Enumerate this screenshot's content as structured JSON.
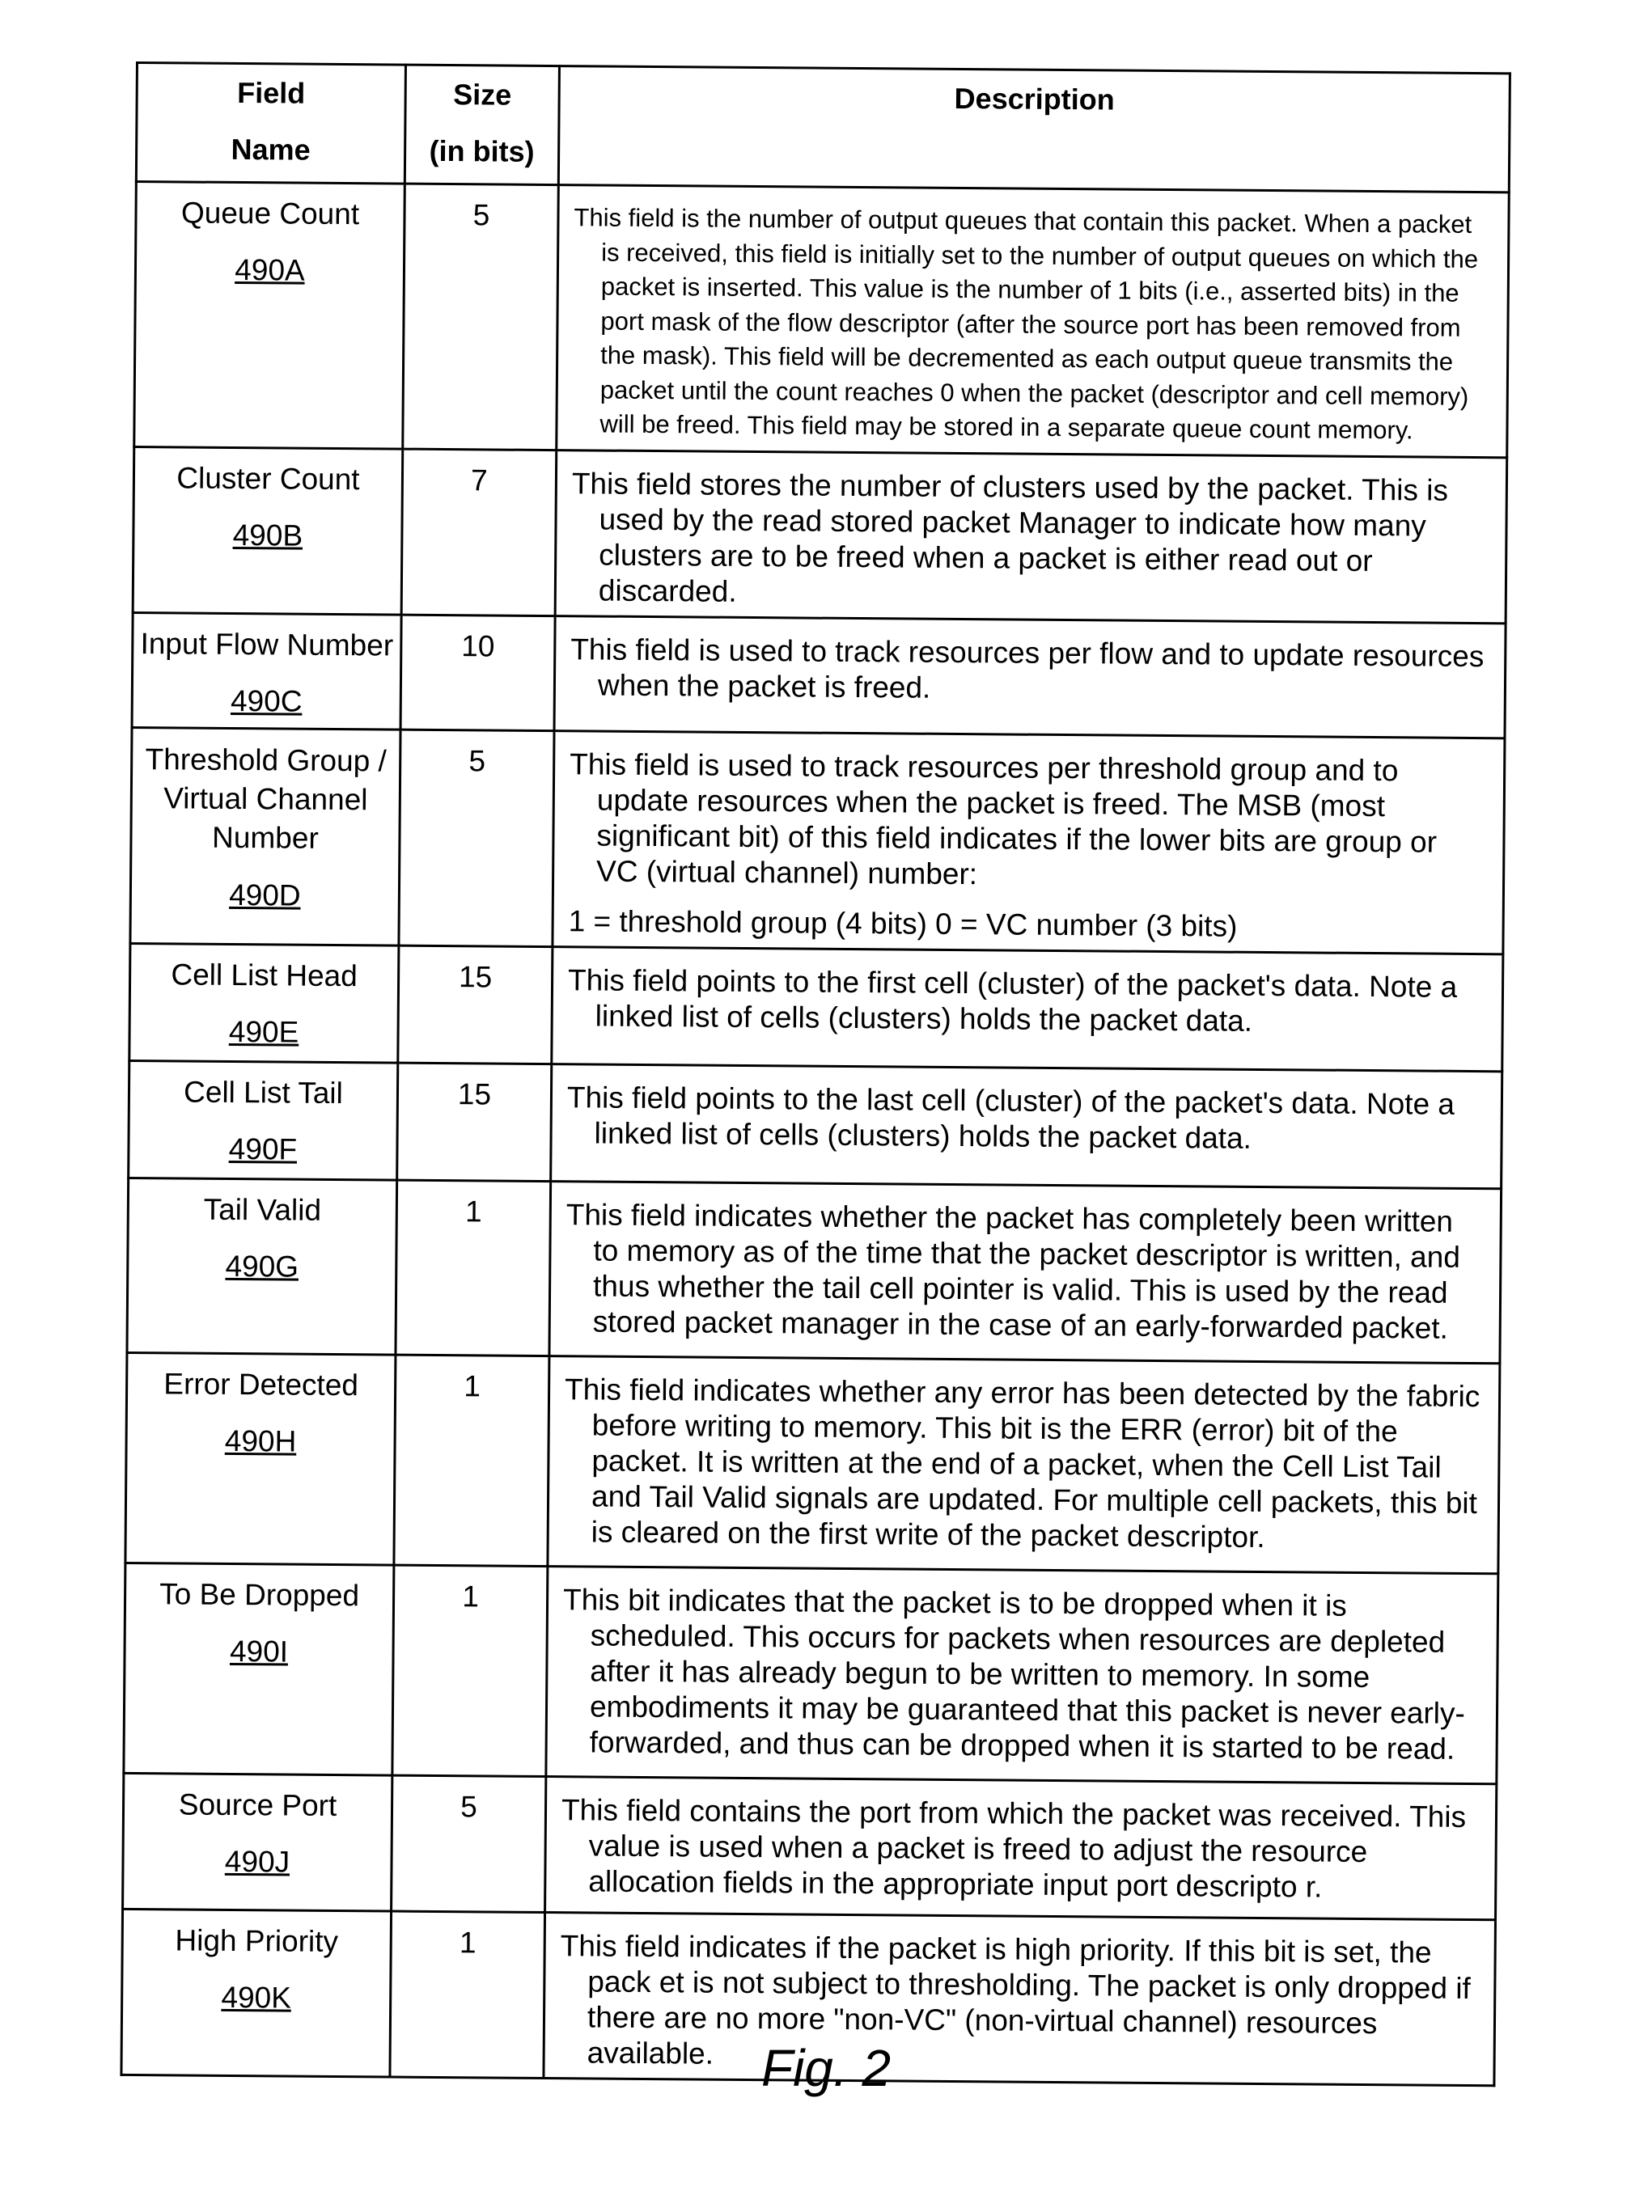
{
  "table": {
    "headers": {
      "field_line1": "Field",
      "field_line2": "Name",
      "size_line1": "Size",
      "size_line2": "(in bits)",
      "description": "Description"
    },
    "rows": [
      {
        "name": "Queue Count",
        "ref": "490A",
        "size": "5",
        "description": "This field is the number of output queues that contain this packet.  When a packet is received, this field is initially set to the number of output queues on which the packet is inserted.  This value is the number   of  1 bits (i.e., asserted bits) in the port mask of the flow descriptor (after the source port has been removed from the mask).  This field will be    decremented as each output queue transmits the packet until the count reaches 0 when the packet (descriptor and cell memory) will be freed.  This field may be stored in a separate queue count memory."
      },
      {
        "name": "Cluster Count",
        "ref": "490B",
        "size": "7",
        "description": "This field stores the number of clusters used by the packet. This is used by the read stored packet Manager to indicate how many clusters are to be freed when a packet is either read out or discarded."
      },
      {
        "name": "Input Flow Number",
        "ref": "490C",
        "size": "10",
        "description": "This field is used to track resources per flow and to update resources when the packet is freed."
      },
      {
        "name": "Threshold Group / Virtual Channel Number",
        "ref": "490D",
        "size": "5",
        "description": "This field is used to track resources per threshold group and to update resources when the packet is freed. The MSB (most significant bit) of this field indicates if the lower bits are group or VC (virtual channel) number:",
        "description_extra": "1 = threshold group (4 bits)   0 = VC number (3 bits)"
      },
      {
        "name": "Cell List Head",
        "ref": "490E",
        "size": "15",
        "description": "This field points to the first cell (cluster) of the packet's data.  Note a linked list of cells (clusters) holds the packet data."
      },
      {
        "name": "Cell List Tail",
        "ref": "490F",
        "size": "15",
        "description": "This field points to the last cell (cluster) of the packet's data.  Note a linked list of cells (clusters) holds the packet data."
      },
      {
        "name": "Tail Valid",
        "ref": "490G",
        "size": "1",
        "description": "This field indicates whether the packet has completely been written to memory as of the time that the packet descriptor is written, and thus whether the tail cell pointer is valid. This is used by the read stored packet manager in the case of an early-forwarded packet."
      },
      {
        "name": "Error Detected",
        "ref": "490H",
        "size": "1",
        "description": "This field indicates whether any error has been detected by the fabric before writing to memory. This bit is the ERR (error) bit of the packet. It is written at the end of a packet, when the Cell List Tail and Tail Valid signals are updated. For multiple cell packets, this bit is cleared on the first write of the packet descriptor."
      },
      {
        "name": "To Be Dropped",
        "ref": "490I",
        "size": "1",
        "description": "This bit indicates that the packet is to be dropped when it is scheduled. This occurs for packets when resources are depleted after it has already begun to be written to memory. In some embodiments it may be guaranteed that this packet is never early-forwarded, and thus can be dropped when it is started to be read."
      },
      {
        "name": "Source Port",
        "ref": "490J",
        "size": "5",
        "description": "This field contains the port from which the packet was received.  This value is used when a packet is freed to adjust the resource allocation fields in the appropriate input port descripto r."
      },
      {
        "name": "High Priority",
        "ref": "490K",
        "size": "1",
        "description": "This field indicates if the packet is high priority. If this bit is set, the pack et is not subject to thresholding. The packet is only dropped if there are no more \"non-VC\" (non-virtual channel) resources available."
      }
    ]
  },
  "caption": "Fig. 2"
}
